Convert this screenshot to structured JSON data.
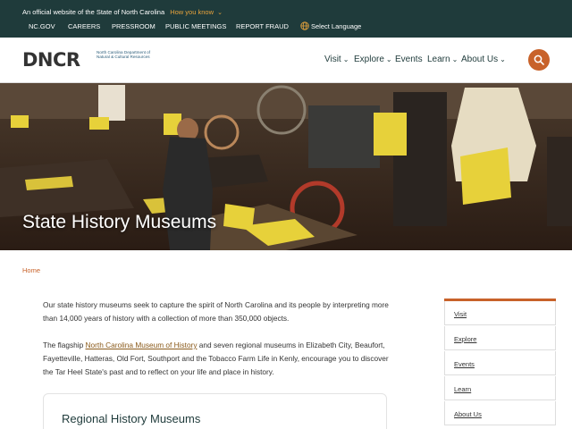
{
  "official_bar": {
    "statement": "An official website of the State of North Carolina",
    "how_you_know": "How you know",
    "links": [
      "NC.GOV",
      "CAREERS",
      "PRESSROOM",
      "PUBLIC MEETINGS",
      "REPORT FRAUD"
    ],
    "language": "Select Language"
  },
  "header": {
    "logo_text": "DNCR",
    "logo_subtitle": "North Carolina Department of Natural & Cultural Resources",
    "nav": [
      "Visit",
      "Explore",
      "Events",
      "Learn",
      "About Us"
    ],
    "nav_has_dropdown": [
      true,
      true,
      false,
      true,
      true
    ]
  },
  "hero": {
    "title": "State History Museums",
    "sign_1": "Georgia \"Tiny\" Broadwick",
    "sign_2": "Women Writers"
  },
  "breadcrumb": {
    "home": "Home"
  },
  "content": {
    "para1": "Our state history museums seek to capture the spirit of North Carolina and its people by interpreting more than 14,000 years of history with a collection of more than 350,000 objects.",
    "para2_before": "The flagship ",
    "para2_link": "North Carolina Museum of History",
    "para2_after": " and seven regional museums in Elizabeth City, Beaufort, Fayetteville, Hatteras, Old Fort, Southport and the Tobacco Farm Life in Kenly, encourage you to discover the Tar Heel State's past and to reflect on your life and place in history.",
    "card_title": "Regional History Museums"
  },
  "sidebar": {
    "items": [
      "Visit",
      "Explore",
      "Events",
      "Learn",
      "About Us"
    ]
  },
  "colors": {
    "official_bar": "#1f3b3b",
    "accent": "#c8622a",
    "logo_blue": "#2b7fb8",
    "link_gold": "#e7a33c"
  }
}
